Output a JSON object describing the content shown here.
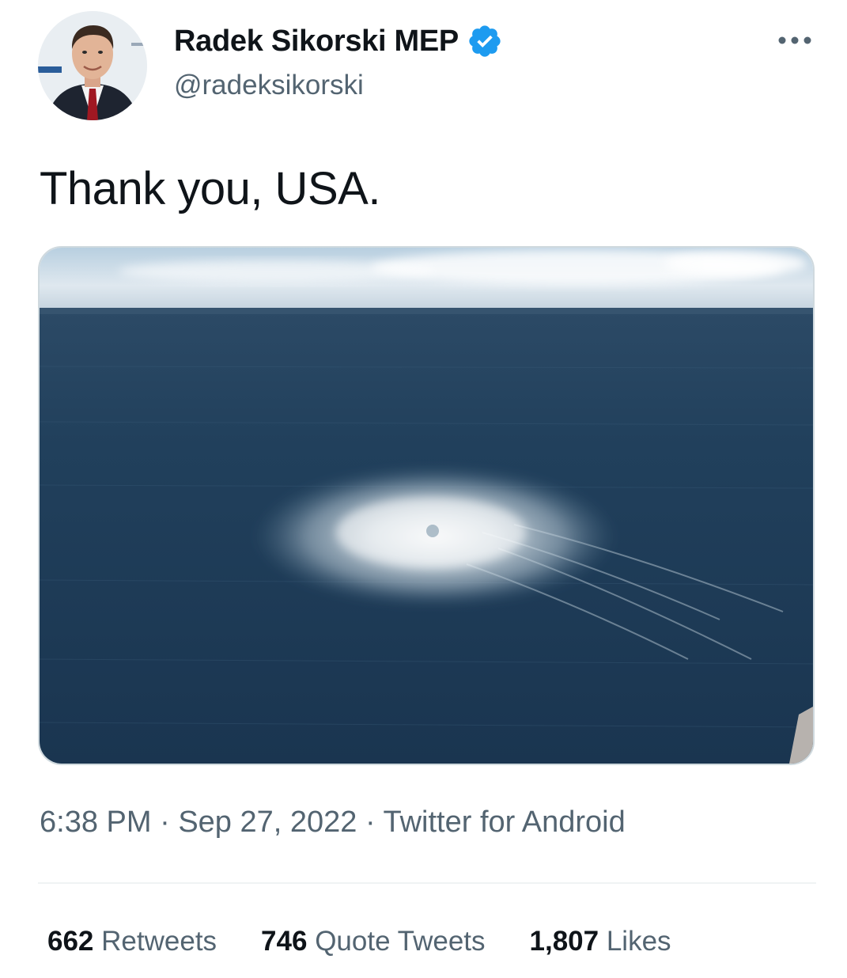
{
  "header": {
    "display_name": "Radek Sikorski MEP",
    "handle": "@radeksikorski",
    "verified_icon": "verified-badge-icon",
    "more_icon": "more-horizontal-icon"
  },
  "tweet": {
    "text": "Thank you, USA.",
    "media_icon": "photo-sea-gas-leak"
  },
  "meta": {
    "time": "6:38 PM",
    "separator": "·",
    "date": "Sep 27, 2022",
    "source": "Twitter for Android"
  },
  "stats": [
    {
      "count": "662",
      "label": "Retweets"
    },
    {
      "count": "746",
      "label": "Quote Tweets"
    },
    {
      "count": "1,807",
      "label": "Likes"
    }
  ],
  "colors": {
    "verified_blue": "#1d9bf0",
    "secondary_text": "#536471",
    "primary_text": "#0f1419"
  }
}
